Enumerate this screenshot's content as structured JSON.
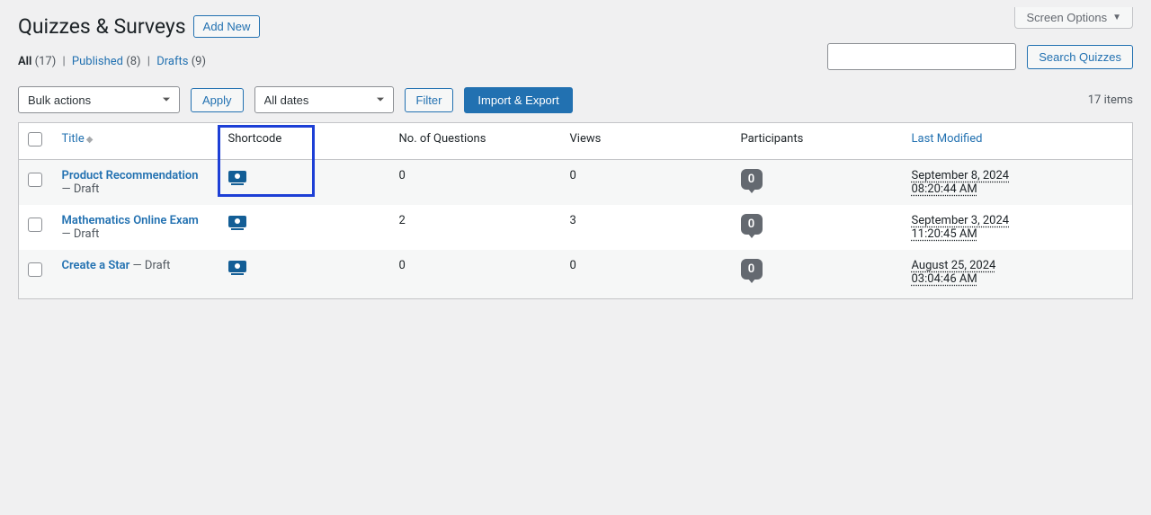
{
  "screen_options_label": "Screen Options",
  "page_title": "Quizzes & Surveys",
  "add_new_label": "Add New",
  "filters": {
    "all_label": "All",
    "all_count": "(17)",
    "published_label": "Published",
    "published_count": "(8)",
    "drafts_label": "Drafts",
    "drafts_count": "(9)"
  },
  "search": {
    "button": "Search Quizzes"
  },
  "bulk": {
    "bulk_actions": "Bulk actions",
    "apply": "Apply",
    "all_dates": "All dates",
    "filter": "Filter",
    "import_export": "Import & Export"
  },
  "items_count": "17 items",
  "columns": {
    "title": "Title",
    "shortcode": "Shortcode",
    "questions": "No. of Questions",
    "views": "Views",
    "participants": "Participants",
    "modified": "Last Modified"
  },
  "rows": [
    {
      "title": "Product Recommendation",
      "status": " — Draft",
      "questions": "0",
      "views": "0",
      "participants": "0",
      "modified1": "September 8, 2024",
      "modified2": "08:20:44 AM"
    },
    {
      "title": "Mathematics Online Exam",
      "status": " — Draft",
      "questions": "2",
      "views": "3",
      "participants": "0",
      "modified1": "September 3, 2024",
      "modified2": "11:20:45 AM"
    },
    {
      "title": "Create a Star",
      "status": " — Draft",
      "questions": "0",
      "views": "0",
      "participants": "0",
      "modified1": "August 25, 2024",
      "modified2": "03:04:46 AM"
    }
  ]
}
